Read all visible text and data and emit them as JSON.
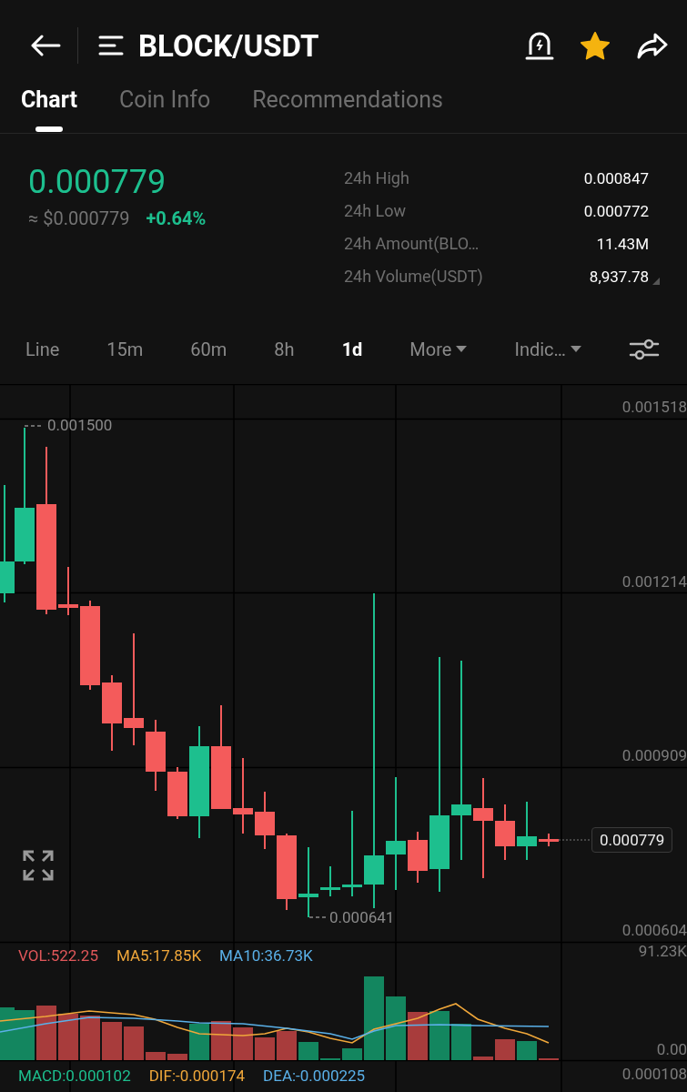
{
  "header": {
    "title": "BLOCK/USDT",
    "favorite": true
  },
  "tabs": [
    {
      "label": "Chart",
      "selected": true
    },
    {
      "label": "Coin Info",
      "selected": false
    },
    {
      "label": "Recommendations",
      "selected": false
    }
  ],
  "ticker": {
    "price": "0.000779",
    "usd": "≈ $0.000779",
    "change": "+0.64%",
    "stats": [
      {
        "label": "24h High",
        "value": "0.000847"
      },
      {
        "label": "24h Low",
        "value": "0.000772"
      },
      {
        "label": "24h Amount(BLO…",
        "value": "11.43M"
      },
      {
        "label": "24h Volume(USDT)",
        "value": "8,937.78"
      }
    ]
  },
  "intervals": [
    {
      "label": "Line",
      "kind": "option",
      "selected": false
    },
    {
      "label": "15m",
      "kind": "option",
      "selected": false
    },
    {
      "label": "60m",
      "kind": "option",
      "selected": false
    },
    {
      "label": "8h",
      "kind": "option",
      "selected": false
    },
    {
      "label": "1d",
      "kind": "option",
      "selected": true
    },
    {
      "label": "More",
      "kind": "dropdown",
      "selected": false
    },
    {
      "label": "Indic…",
      "kind": "dropdown",
      "selected": false
    }
  ],
  "chart": {
    "y_labels": [
      "0.001518",
      "0.001214",
      "0.000909",
      "0.000604"
    ],
    "high_label": "0.001500",
    "low_label": "0.000641",
    "last_price": "0.000779"
  },
  "volume": {
    "legend": [
      {
        "text": "VOL:522.25",
        "color": "#e0575a"
      },
      {
        "text": "MA5:17.85K",
        "color": "#f0a73a"
      },
      {
        "text": "MA10:36.73K",
        "color": "#5ab0e8"
      }
    ],
    "max_label": "91.23K",
    "min_label": "0.00"
  },
  "macd": {
    "legend": [
      {
        "text": "MACD:0.000102",
        "color": "#1dbf8e"
      },
      {
        "text": "DIF:-0.000174",
        "color": "#f0a73a"
      },
      {
        "text": "DEA:-0.000225",
        "color": "#5ab0e8"
      }
    ],
    "axis_label": "0.000108"
  }
}
